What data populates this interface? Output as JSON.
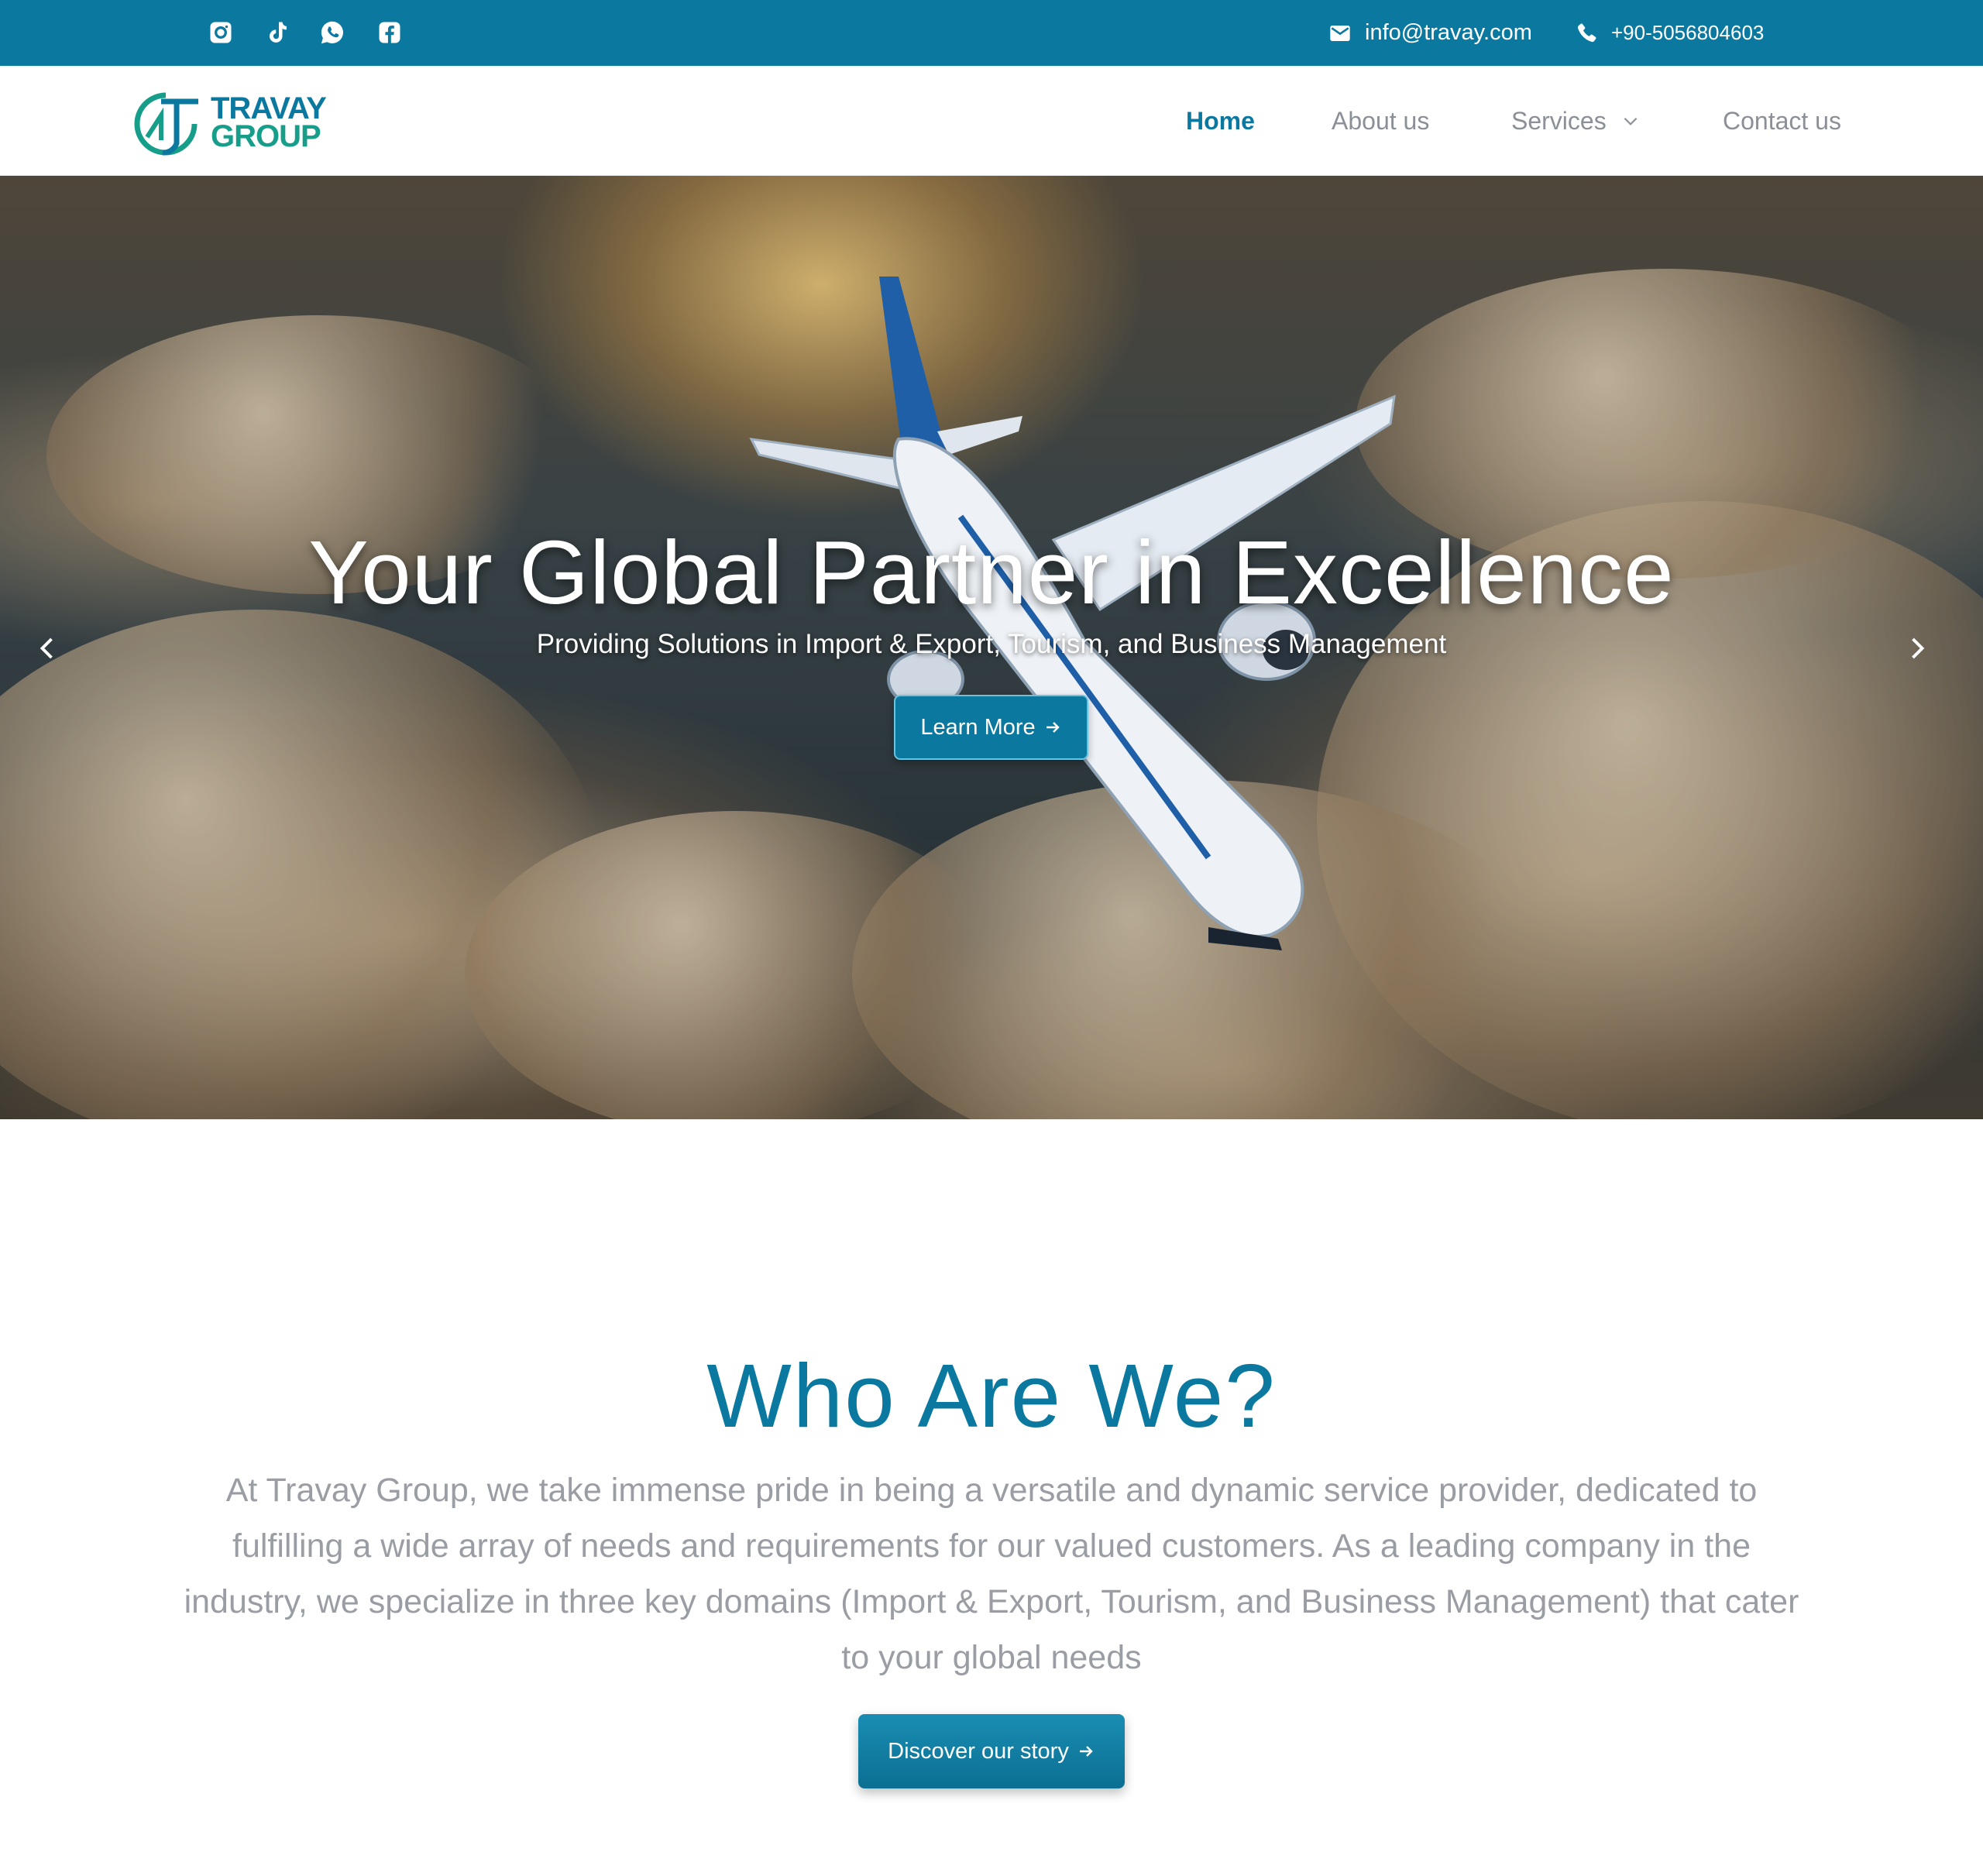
{
  "topbar": {
    "social_icons": [
      "instagram-icon",
      "tiktok-icon",
      "whatsapp-icon",
      "facebook-icon"
    ],
    "email": "info@travay.com",
    "phone": "+90-5056804603",
    "background": "#0b799f"
  },
  "brand": {
    "line1": "TRAVAY",
    "line2": "GROUP",
    "colors": {
      "primary": "#0b799f",
      "secondary": "#169e8a"
    }
  },
  "nav": {
    "items": [
      {
        "label": "Home",
        "active": true
      },
      {
        "label": "About us",
        "active": false
      },
      {
        "label": "Services",
        "active": false,
        "has_dropdown": true
      },
      {
        "label": "Contact us",
        "active": false
      }
    ]
  },
  "hero": {
    "title": "Your Global Partner in Excellence",
    "subtitle": "Providing Solutions in Import & Export, Tourism, and Business Management",
    "cta_label": "Learn More",
    "cta_icon": "arrow-right-icon",
    "prev_icon": "chevron-left-icon",
    "next_icon": "chevron-right-icon"
  },
  "about": {
    "title": "Who Are We?",
    "text": "At Travay Group, we take immense pride in being a versatile and dynamic service provider, dedicated to fulfilling a wide array of needs and requirements for our valued customers. As a leading company in the industry, we specialize in three key domains (Import & Export, Tourism, and Business Management) that cater to your global needs",
    "cta_label": "Discover our story",
    "cta_icon": "arrow-right-icon"
  }
}
